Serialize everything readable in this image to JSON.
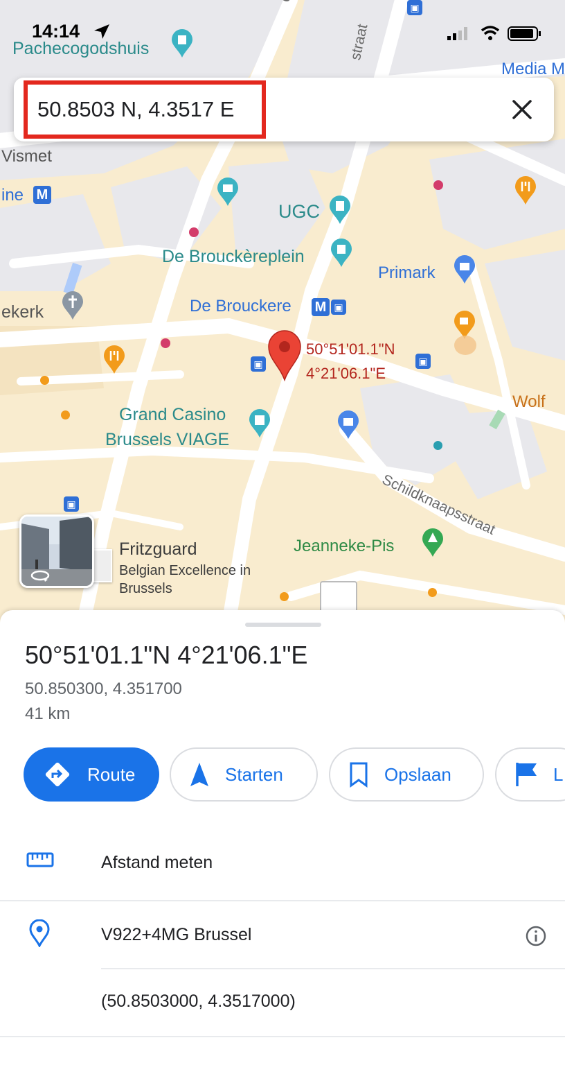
{
  "status_bar": {
    "time": "14:14"
  },
  "search": {
    "value": "50.8503 N, 4.3517 E"
  },
  "map": {
    "labels": {
      "pachecogodshuis": "Pachecogodshuis",
      "media": "Media M",
      "vismet": "Vismet",
      "ine": "ine",
      "ugc": "UGC",
      "de_brouckereplein": "De Brouckèreplein",
      "primark": "Primark",
      "ekerk": "ekerk",
      "de_brouckere": "De Brouckere",
      "grand_casino_1": "Grand Casino",
      "grand_casino_2": "Brussels VIAGE",
      "wolf": "Wolf",
      "schildknaapsstraat": "Schildknaapsstraat",
      "jeanneke_pis": "Jeanneke-Pis",
      "fritzguard_name": "Fritzguard",
      "fritzguard_desc_1": "Belgian Excellence in",
      "fritzguard_desc_2": "Brussels",
      "street_top_1": "ensestraat",
      "street_top_2": "straat",
      "metro_letter": "M"
    },
    "pin": {
      "line1": "50°51'01.1\"N",
      "line2": "4°21'06.1\"E"
    }
  },
  "place": {
    "title": "50°51'01.1\"N 4°21'06.1\"E",
    "decimal": "50.850300, 4.351700",
    "distance": "41 km"
  },
  "actions": {
    "route": "Route",
    "start": "Starten",
    "save": "Opslaan",
    "label": "L"
  },
  "details": {
    "measure": "Afstand meten",
    "plus_code": "V922+4MG Brussel",
    "coords": "(50.8503000, 4.3517000)"
  },
  "colors": {
    "accent": "#1a73e8",
    "pin": "#d93025",
    "highlight": "#e3281e"
  }
}
